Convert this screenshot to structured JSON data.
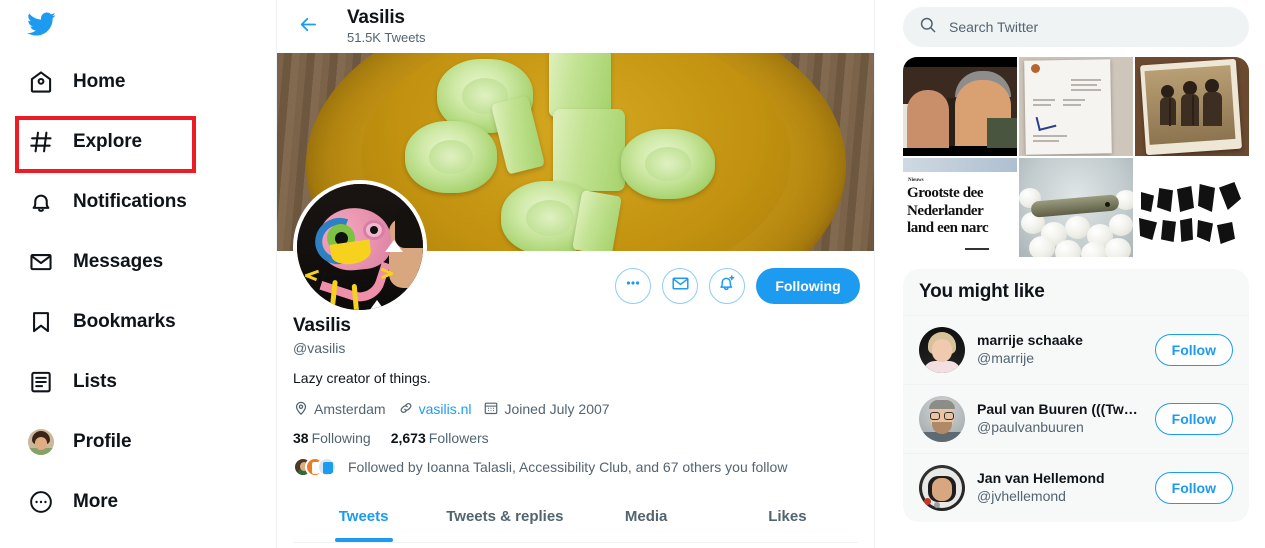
{
  "brand": {
    "logo_icon": "twitter-bird-icon",
    "accent_color": "#1d9bf0",
    "highlight_color": "#ed1c24",
    "muted_color": "#536471"
  },
  "sidebar": {
    "items": [
      {
        "label": "Home",
        "icon": "home-icon"
      },
      {
        "label": "Explore",
        "icon": "hashtag-icon"
      },
      {
        "label": "Notifications",
        "icon": "bell-icon"
      },
      {
        "label": "Messages",
        "icon": "envelope-icon"
      },
      {
        "label": "Bookmarks",
        "icon": "bookmark-icon"
      },
      {
        "label": "Lists",
        "icon": "list-icon"
      },
      {
        "label": "Profile",
        "icon": "avatar-icon"
      },
      {
        "label": "More",
        "icon": "more-circle-icon"
      }
    ],
    "highlighted_item": "Explore"
  },
  "header": {
    "back_icon": "back-arrow-icon",
    "title": "Vasilis",
    "subtitle": "51.5K Tweets"
  },
  "profile": {
    "banner_alt": "bowl of sliced cucumbers on a wooden table",
    "avatar_alt": "cartoon bird drawing on a black t-shirt",
    "name": "Vasilis",
    "handle": "@vasilis",
    "bio": "Lazy creator of things.",
    "location": "Amsterdam",
    "location_icon": "location-pin-icon",
    "website": "vasilis.nl",
    "website_icon": "link-icon",
    "joined": "Joined July 2007",
    "joined_icon": "calendar-icon",
    "following_count": "38",
    "following_label": "Following",
    "followers_count": "2,673",
    "followers_label": "Followers",
    "followed_by": "Followed by Ioanna Talasli, Accessibility Club, and 67 others you follow",
    "actions": {
      "more_icon": "more-dots-icon",
      "message_icon": "envelope-icon",
      "notify_icon": "bell-plus-icon",
      "follow_state_label": "Following"
    },
    "tabs": [
      {
        "label": "Tweets",
        "active": true
      },
      {
        "label": "Tweets & replies",
        "active": false
      },
      {
        "label": "Media",
        "active": false
      },
      {
        "label": "Likes",
        "active": false
      }
    ]
  },
  "search": {
    "icon": "search-icon",
    "placeholder": "Search Twitter",
    "value": ""
  },
  "media_grid": {
    "tiles": [
      {
        "alt": "two men talking in a film still"
      },
      {
        "alt": "scan of an official white letter"
      },
      {
        "alt": "sepia photograph of a band on stage"
      },
      {
        "alt": "news headline: Grootste deel Nederlanders land een narc",
        "kicker": "Nieuws",
        "headline_line1": "Grootste dee",
        "headline_line2": "Nederlander",
        "headline_line3": "land een narc"
      },
      {
        "alt": "an eel resting on white eggs"
      },
      {
        "alt": "black abstract glyph lettering on white"
      }
    ]
  },
  "you_might_like": {
    "title": "You might like",
    "suggestions": [
      {
        "name": "marrije schaake",
        "handle": "@marrije",
        "button": "Follow"
      },
      {
        "name": "Paul van Buuren (((Tw…",
        "handle": "@paulvanbuuren",
        "button": "Follow"
      },
      {
        "name": "Jan van Hellemond",
        "handle": "@jvhellemond",
        "button": "Follow"
      }
    ]
  }
}
